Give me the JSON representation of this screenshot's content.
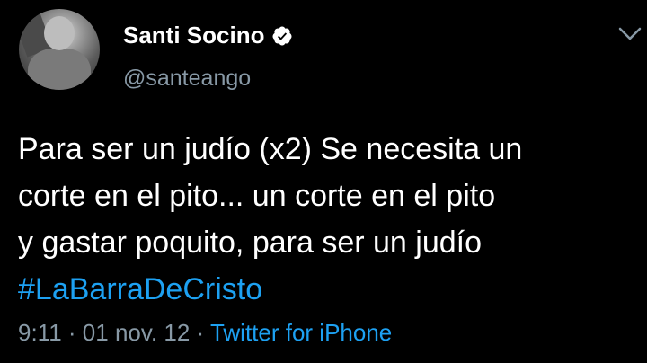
{
  "author": {
    "display_name": "Santi Socino",
    "handle": "@santeango",
    "verified_icon": "verified-badge-icon"
  },
  "tweet": {
    "lines": [
      "Para ser un judío (x2) Se necesita un",
      "corte en el pito... un corte en el pito",
      "y gastar poquito, para ser un judío"
    ],
    "hashtag": "#LaBarraDeCristo"
  },
  "meta": {
    "time": "9:11",
    "sep1": " · ",
    "date": "01 nov. 12",
    "sep2": " · ",
    "source": "Twitter for iPhone"
  },
  "colors": {
    "background": "#000000",
    "text": "#ffffff",
    "secondary": "#8899a6",
    "accent": "#1da1f2"
  },
  "icons": [
    "verified-badge-icon",
    "chevron-down-icon",
    "avatar"
  ]
}
